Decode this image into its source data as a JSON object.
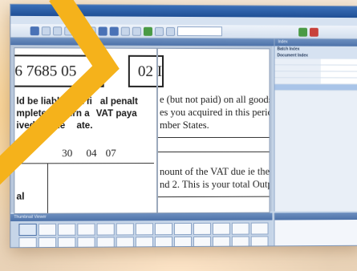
{
  "app": {
    "title": "",
    "menu": [],
    "zoom": ""
  },
  "document": {
    "panel_title": "",
    "right_panel_title": "",
    "vat_number": "6 7685 05",
    "box_partial": "02 I",
    "warning_line1": "ld be liable to a fi",
    "warning_line1b": "al penalt",
    "warning_line2": "mpleted return a",
    "warning_line2b": "VAT paya",
    "warning_line3": "ived by the",
    "warning_line3b": "ate.",
    "date_day": "30",
    "date_month": "04",
    "date_year": "07",
    "side_label": "al",
    "right_line1": "e (but not paid) on all goods",
    "right_line2": "es you acquired in this perioc",
    "right_line3": "mber States.",
    "right_line4": "nount of the VAT due ie the",
    "right_line5": "nd 2. This is your total Output"
  },
  "properties": {
    "panel_title": "Index",
    "category1": "Batch Index",
    "category2": "Document Index",
    "rows": []
  },
  "thumbnails": {
    "panel_title": "Thumbnail Viewer",
    "count": 26
  },
  "description": {
    "title": "",
    "text": ""
  },
  "colors": {
    "accent": "#f5b21b",
    "titlebar": "#1f4f95"
  }
}
